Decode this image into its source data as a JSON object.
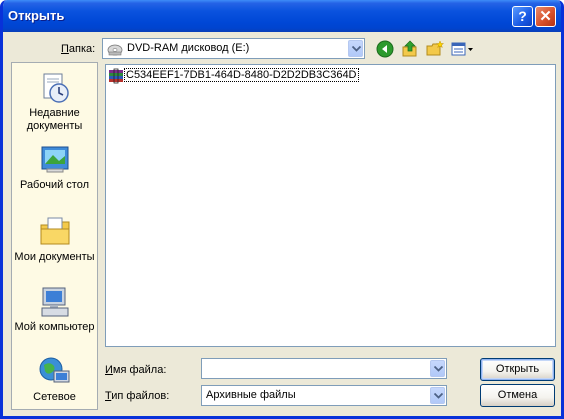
{
  "window": {
    "title": "Открыть"
  },
  "title_buttons": {
    "help": "?",
    "close": "✕"
  },
  "lookin": {
    "label_accel": "П",
    "label_rest": "апка:",
    "value": "DVD-RAM дисковод (E:)"
  },
  "toolbar_icons": [
    "back-icon",
    "up-folder-icon",
    "new-folder-icon",
    "view-menu-icon"
  ],
  "places": [
    {
      "label": "Недавние документы",
      "icon": "recent-documents-icon"
    },
    {
      "label": "Рабочий стол",
      "icon": "desktop-icon"
    },
    {
      "label": "Мои документы",
      "icon": "my-documents-icon"
    },
    {
      "label": "Мой компьютер",
      "icon": "my-computer-icon"
    },
    {
      "label": "Сетевое",
      "icon": "network-icon"
    }
  ],
  "files": [
    {
      "name": "C534EEF1-7DB1-464D-8480-D2D2DB3C364D",
      "icon": "archive-file-icon"
    }
  ],
  "filename": {
    "label_accel": "И",
    "label_rest": "мя файла:",
    "value": ""
  },
  "filetype": {
    "label_accel": "Т",
    "label_rest": "ип файлов:",
    "value": "Архивные файлы"
  },
  "buttons": {
    "open": "Открыть",
    "cancel": "Отмена"
  },
  "colors": {
    "titlebar": "#0a52de",
    "dialog_bg": "#ece9d8",
    "places_bg": "#fefae4",
    "field_border": "#7f9db9"
  }
}
